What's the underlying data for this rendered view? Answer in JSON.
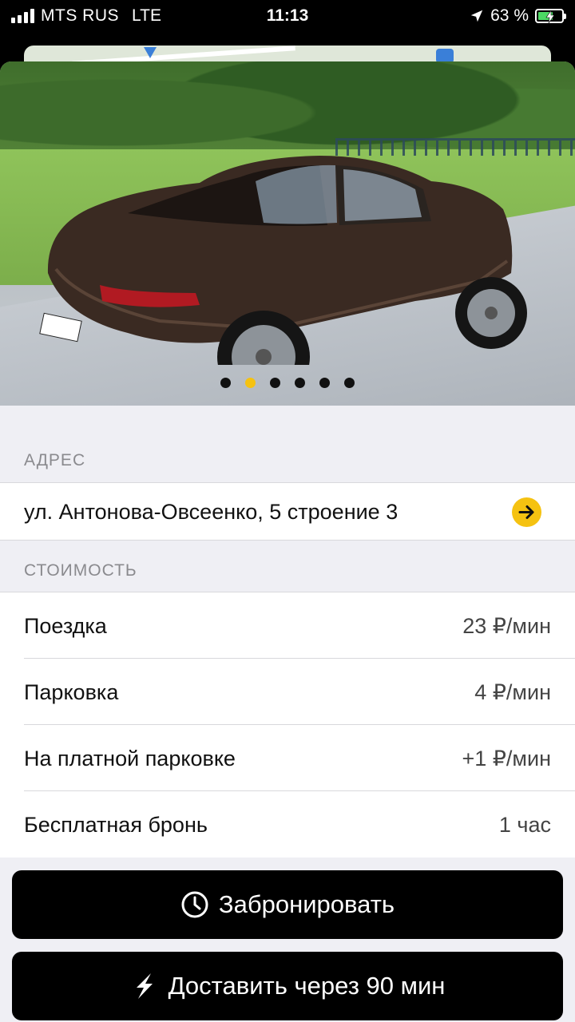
{
  "status_bar": {
    "carrier": "MTS RUS",
    "network": "LTE",
    "time": "11:13",
    "battery": "63 %",
    "battery_level": 0.63
  },
  "gallery": {
    "photo_count": 6,
    "active_index": 1,
    "active_color": "#f5c211"
  },
  "address": {
    "label": "АДРЕС",
    "value": "ул. Антонова-Овсеенко, 5 строение 3",
    "button_icon": "arrow-right-icon"
  },
  "pricing": {
    "label": "СТОИМОСТЬ",
    "items": [
      {
        "name": "Поездка",
        "value": "23 ₽/мин"
      },
      {
        "name": "Парковка",
        "value": "4 ₽/мин"
      },
      {
        "name": "На платной парковке",
        "value": "+1 ₽/мин"
      },
      {
        "name": "Бесплатная бронь",
        "value": "1 час"
      }
    ]
  },
  "actions": {
    "book": {
      "label": "Забронировать",
      "icon": "clock-icon"
    },
    "deliver": {
      "label": "Доставить через 90 мин",
      "icon": "lightning-icon"
    }
  },
  "colors": {
    "accent": "#f5c211",
    "button_bg": "#000000",
    "sheet_bg": "#efeff4"
  }
}
